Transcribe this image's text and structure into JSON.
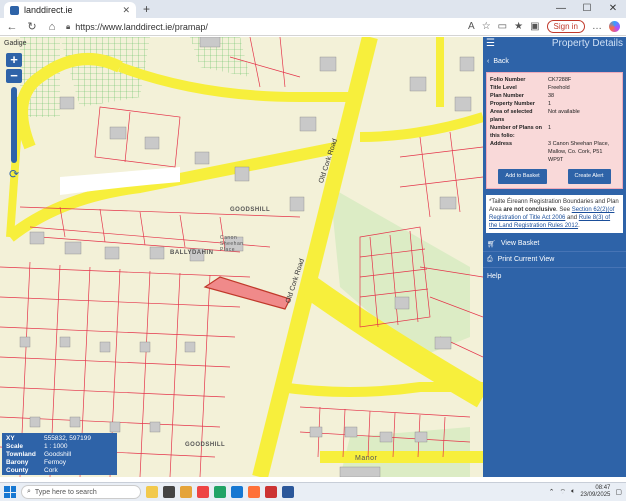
{
  "browser": {
    "tab_title": "landdirect.ie",
    "url": "https://www.landdirect.ie/pramap/",
    "signin_label": "Sign in"
  },
  "map": {
    "corner_label": "Gadige",
    "place_labels": [
      "GOODSHILL",
      "BALLYDAHIN",
      "Canon Sheehan Place",
      "GOODSHILL",
      "Manor"
    ],
    "road_labels": [
      "Old Cork Road",
      "Old Cork Road"
    ]
  },
  "infobox": {
    "rows": [
      {
        "k": "XY",
        "v": "555832, 597199"
      },
      {
        "k": "Scale",
        "v": "1 : 1000"
      },
      {
        "k": "Townland",
        "v": "Goodshill"
      },
      {
        "k": "Barony",
        "v": "Fermoy"
      },
      {
        "k": "County",
        "v": "Cork"
      }
    ]
  },
  "panel": {
    "title": "Property Details",
    "back_label": "Back",
    "details": [
      {
        "k": "Folio Number",
        "v": "CK7288F"
      },
      {
        "k": "Title Level",
        "v": "Freehold"
      },
      {
        "k": "Plan Number",
        "v": "38"
      },
      {
        "k": "Property Number",
        "v": "1"
      },
      {
        "k": "Area of selected plans",
        "v": "Not available"
      },
      {
        "k": "Number of Plans on this folio:",
        "v": "1"
      },
      {
        "k": "Address",
        "v": "3 Canon Sheehan Place, Mallow, Co. Cork, P51 WP9T"
      }
    ],
    "add_basket_label": "Add to Basket",
    "create_alert_label": "Create Alert",
    "disclaimer": {
      "p1": "*Tailte Éireann Registration Boundaries and Plan Area ",
      "bold": "are not conclusive",
      "p2": ". See ",
      "link1": "Section 62(2)(of Registration of Title Act 2006",
      "p3": " and ",
      "link2": "Rule 8(3) of the Land Registration Rules 2012",
      "p4": "."
    },
    "menu": [
      {
        "label": "View Basket",
        "icon": "cart-icon"
      },
      {
        "label": "Print Current View",
        "icon": "print-icon"
      },
      {
        "label": "Help",
        "icon": ""
      }
    ]
  },
  "taskbar": {
    "search_placeholder": "Type here to search",
    "time": "08:47",
    "date": "23/09/2025"
  },
  "colors": {
    "panel_blue": "#2e63a8",
    "road_yellow": "#f7ef3c",
    "parcel_red": "#e4344a",
    "details_pink": "#f9d9d9"
  }
}
